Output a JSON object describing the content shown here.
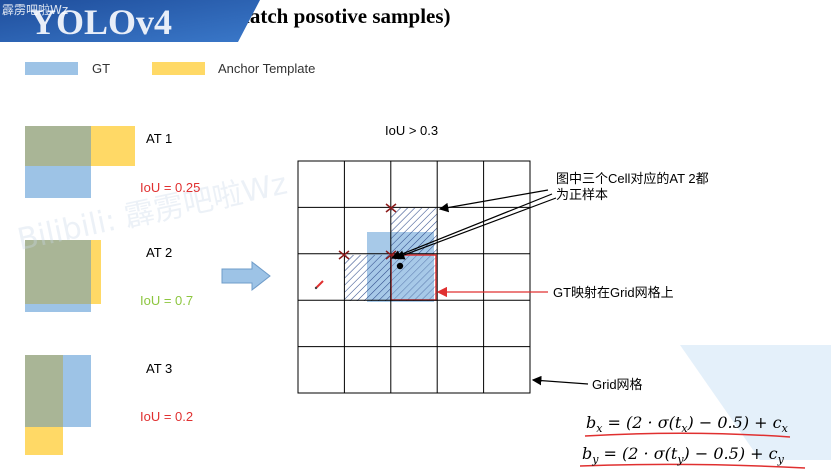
{
  "header": {
    "banner_text": "YOLOv4",
    "watermark_top": "霹雳吧啦Wz",
    "title": "优化策略 - IoU threshold(match posotive samples)"
  },
  "legend": {
    "gt_label": "GT",
    "anchor_label": "Anchor Template"
  },
  "colors": {
    "gt": "#9dc3e6",
    "anchor": "#ffd966",
    "overlap": "#a9b596",
    "iou_red": "#e03030",
    "iou_green": "#8dc63f",
    "grid": "#000000",
    "red_box": "#e03030",
    "hatch": "#2e4a8a"
  },
  "anchors": [
    {
      "label": "AT 1",
      "iou": "IoU = 0.25",
      "iou_color": "red"
    },
    {
      "label": "AT 2",
      "iou": "IoU = 0.7",
      "iou_color": "green"
    },
    {
      "label": "AT 3",
      "iou": "IoU = 0.2",
      "iou_color": "red"
    }
  ],
  "grid": {
    "threshold": "IoU > 0.3",
    "rows": 5,
    "cols": 5,
    "callout_positive": "图中三个Cell对应的AT 2都为正样本",
    "callout_positive_line1": "图中三个Cell对应的AT 2都",
    "callout_positive_line2": "为正样本",
    "callout_gt": "GT映射在Grid网格上",
    "callout_grid": "Grid网格"
  },
  "watermark": "Bilibili: 霹雳吧啦Wz",
  "formulas": {
    "bx": "b_x = (2 · σ(t_x) − 0.5) + c_x",
    "by": "b_y = (2 · σ(t_y) − 0.5) + c_y"
  }
}
